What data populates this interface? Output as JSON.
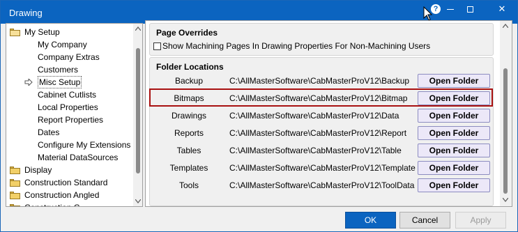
{
  "window": {
    "title": "Drawing"
  },
  "tree": {
    "items": [
      {
        "label": "My Setup",
        "type": "folder-open",
        "level": 0
      },
      {
        "label": "My Company",
        "type": "item",
        "level": 1
      },
      {
        "label": "Company Extras",
        "type": "item",
        "level": 1
      },
      {
        "label": "Customers",
        "type": "item",
        "level": 1
      },
      {
        "label": "Misc Setup",
        "type": "item",
        "level": 1,
        "selected": true
      },
      {
        "label": "Cabinet Cutlists",
        "type": "item",
        "level": 1
      },
      {
        "label": "Local Properties",
        "type": "item",
        "level": 1
      },
      {
        "label": "Report Properties",
        "type": "item",
        "level": 1
      },
      {
        "label": "Dates",
        "type": "item",
        "level": 1
      },
      {
        "label": "Configure My Extensions",
        "type": "item",
        "level": 1
      },
      {
        "label": "Material DataSources",
        "type": "item",
        "level": 1
      },
      {
        "label": "Display",
        "type": "folder",
        "level": 0
      },
      {
        "label": "Construction Standard",
        "type": "folder",
        "level": 0
      },
      {
        "label": "Construction Angled",
        "type": "folder",
        "level": 0
      },
      {
        "label": "Construction C",
        "type": "folder",
        "level": 0
      }
    ]
  },
  "page_overrides": {
    "title": "Page Overrides",
    "checkbox_label": "Show Machining Pages In Drawing Properties For Non-Machining Users",
    "checked": false
  },
  "folder_locations": {
    "title": "Folder Locations",
    "button_label": "Open Folder",
    "rows": [
      {
        "label": "Backup",
        "path": "C:\\AllMasterSoftware\\CabMasterProV12\\Backup"
      },
      {
        "label": "Bitmaps",
        "path": "C:\\AllMasterSoftware\\CabMasterProV12\\Bitmap",
        "highlighted": true
      },
      {
        "label": "Drawings",
        "path": "C:\\AllMasterSoftware\\CabMasterProV12\\Data"
      },
      {
        "label": "Reports",
        "path": "C:\\AllMasterSoftware\\CabMasterProV12\\Report"
      },
      {
        "label": "Tables",
        "path": "C:\\AllMasterSoftware\\CabMasterProV12\\Table"
      },
      {
        "label": "Templates",
        "path": "C:\\AllMasterSoftware\\CabMasterProV12\\Template"
      },
      {
        "label": "Tools",
        "path": "C:\\AllMasterSoftware\\CabMasterProV12\\ToolData"
      }
    ]
  },
  "buttons": {
    "ok": "OK",
    "cancel": "Cancel",
    "apply": "Apply"
  },
  "titlebar_buttons": {
    "help": "?"
  },
  "colors": {
    "titlebar": "#0b64c0",
    "highlight_outline": "#a81010",
    "button_face": "#ece8f8"
  }
}
